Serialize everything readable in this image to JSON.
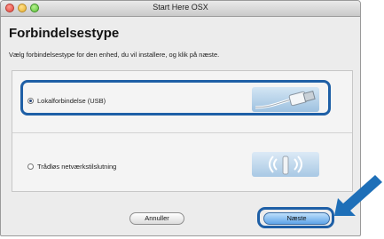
{
  "window": {
    "title": "Start Here OSX"
  },
  "page": {
    "heading": "Forbindelsestype",
    "description": "Vælg forbindelsestype for den enhed, du vil installere, og klik på næste."
  },
  "options": [
    {
      "label": "Lokalforbindelse (USB)",
      "selected": true,
      "icon": "usb-cable-icon"
    },
    {
      "label": "Trådløs netværkstilslutning",
      "selected": false,
      "icon": "wireless-icon"
    }
  ],
  "buttons": {
    "cancel_label": "Annuller",
    "next_label": "Næste"
  },
  "colors": {
    "highlight": "#1e5fa6",
    "arrow": "#1e6fb8",
    "default_button": "#5ea4e8"
  }
}
